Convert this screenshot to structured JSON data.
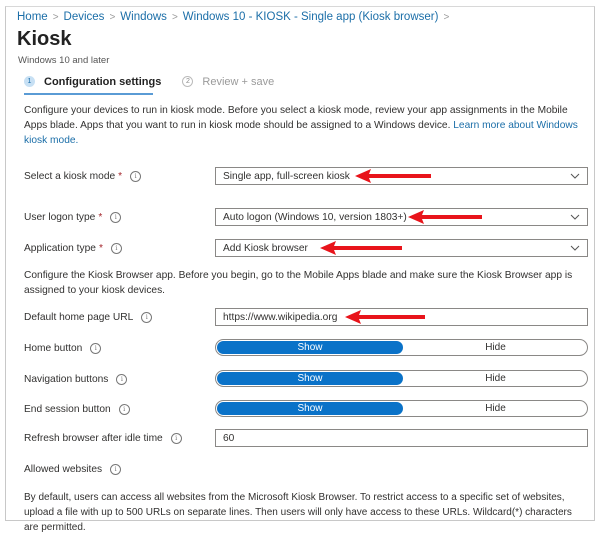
{
  "breadcrumb": [
    "Home",
    "Devices",
    "Windows",
    "Windows 10 - KIOSK - Single app (Kiosk browser)"
  ],
  "page": {
    "title": "Kiosk",
    "subtitle": "Windows 10 and later"
  },
  "steps": [
    {
      "num": "1",
      "label": "Configuration settings",
      "active": true
    },
    {
      "num": "2",
      "label": "Review + save",
      "active": false
    }
  ],
  "intro": {
    "text": "Configure your devices to run in kiosk mode. Before you select a kiosk mode, review your app assignments in the Mobile Apps blade. Apps that you want to run in kiosk mode should be assigned to a Windows device. ",
    "link": "Learn more about Windows kiosk mode."
  },
  "fields": {
    "kiosk_mode": {
      "label": "Select a kiosk mode",
      "required": "*",
      "value": "Single app, full-screen kiosk"
    },
    "logon_type": {
      "label": "User logon type",
      "required": "*",
      "value": "Auto logon (Windows 10, version 1803+)"
    },
    "app_type": {
      "label": "Application type",
      "required": "*",
      "value": "Add Kiosk browser"
    },
    "browser_note": "Configure the Kiosk Browser app. Before you begin, go to the Mobile Apps blade and make sure the Kiosk Browser app is assigned to your kiosk devices.",
    "home_url": {
      "label": "Default home page URL",
      "value": "https://www.wikipedia.org"
    },
    "home_button": {
      "label": "Home button",
      "on": "Show",
      "off": "Hide",
      "selected": "Show"
    },
    "nav_buttons": {
      "label": "Navigation buttons",
      "on": "Show",
      "off": "Hide",
      "selected": "Show"
    },
    "end_session": {
      "label": "End session button",
      "on": "Show",
      "off": "Hide",
      "selected": "Show"
    },
    "refresh_idle": {
      "label": "Refresh browser after idle time",
      "value": "60"
    },
    "allowed_sites": {
      "label": "Allowed websites"
    },
    "allowed_note": "By default, users can access all websites from the Microsoft Kiosk Browser. To restrict access to a specific set of websites, upload a file with up to 500 URLs on separate lines. Then users will only have access to these URLs. Wildcard(*) characters are permitted."
  },
  "icons": {
    "info": "i",
    "chevron": "chevron-down-icon",
    "annotation": "red-arrow-icon"
  },
  "colors": {
    "accent": "#0a72c8",
    "link": "#1b6ea8",
    "required": "#a4262c",
    "annotation": "#e8141b"
  }
}
